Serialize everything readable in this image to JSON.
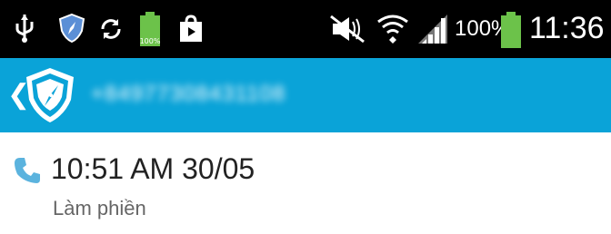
{
  "status_bar": {
    "battery_percent": "100%",
    "time": "11:36",
    "left_icons": [
      "usb-icon",
      "shield-icon",
      "sync-icon",
      "battery-full-icon",
      "shopping-bag-icon"
    ],
    "right_icons": [
      "mute-icon",
      "wifi-icon",
      "signal-icon",
      "battery-icon"
    ],
    "battery_color": "#6cc24a"
  },
  "action_bar": {
    "background": "#0aa3d8",
    "title_blurred": "+84977308431108"
  },
  "call_log": {
    "entry": {
      "time": "10:51 AM 30/05",
      "label": "Làm phiền"
    }
  }
}
